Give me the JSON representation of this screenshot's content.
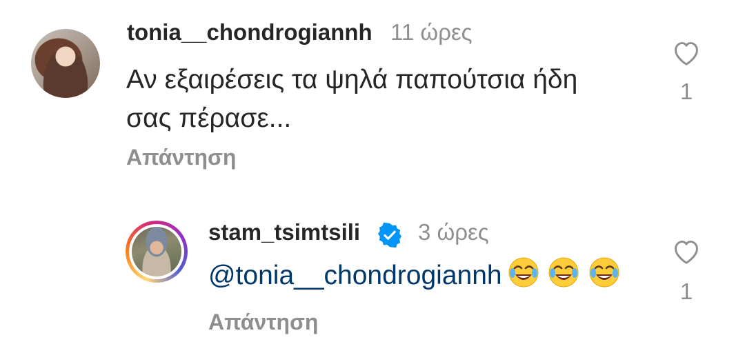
{
  "comments": [
    {
      "username": "tonia__chondrogiannh",
      "time": "11 ώρες",
      "text_line1": "Αν εξαιρέσεις τα ψηλά παπούτσια ήδη",
      "text_line2": "σας πέρασε...",
      "reply_label": "Απάντηση",
      "like_count": "1",
      "avatar_icon": "profile-photo",
      "like_icon": "heart-outline-icon"
    },
    {
      "username": "stam_tsimtsili",
      "verified": true,
      "time": "3 ώρες",
      "mention": "@tonia__chondrogiannh",
      "emojis": [
        "😂",
        "😂",
        "😂"
      ],
      "reply_label": "Απάντηση",
      "like_count": "1",
      "avatar_icon": "profile-photo",
      "like_icon": "heart-outline-icon"
    }
  ],
  "colors": {
    "text": "#262626",
    "secondary": "#8e8e8e",
    "mention": "#00376b",
    "verified": "#0095f6"
  }
}
